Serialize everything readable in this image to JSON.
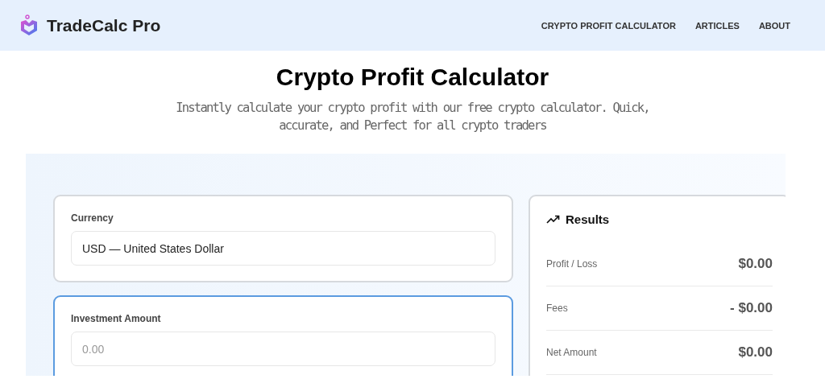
{
  "header": {
    "brand": "TradeCalc Pro",
    "nav": [
      {
        "label": "CRYPTO PROFIT CALCULATOR"
      },
      {
        "label": "ARTICLES"
      },
      {
        "label": "ABOUT"
      }
    ]
  },
  "title": "Crypto Profit Calculator",
  "subtitle": "Instantly calculate your crypto profit with our free crypto calculator. Quick, accurate, and Perfect for all crypto traders",
  "inputs": [
    {
      "label": "Currency",
      "value": "USD — United States Dollar",
      "focused": false
    },
    {
      "label": "Investment Amount",
      "placeholder": "0.00",
      "focused": true
    }
  ],
  "results": {
    "title": "Results",
    "rows": [
      {
        "label": "Profit / Loss",
        "value": "$0.00"
      },
      {
        "label": "Fees",
        "value": "- $0.00"
      },
      {
        "label": "Net Amount",
        "value": "$0.00"
      }
    ]
  }
}
